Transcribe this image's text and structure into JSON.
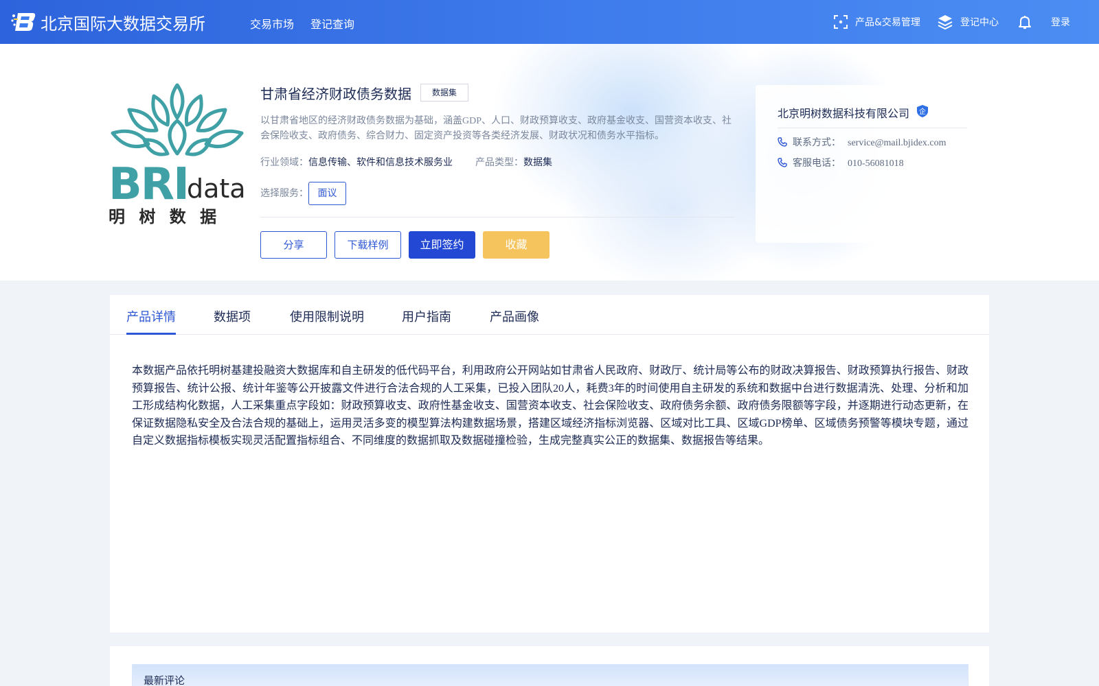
{
  "header": {
    "brand": "北京国际大数据交易所",
    "nav": [
      "交易市场",
      "登记查询"
    ],
    "product_manage": "产品&交易管理",
    "register_center": "登记中心",
    "login": "登录"
  },
  "product": {
    "title": "甘肃省经济财政债务数据",
    "type_badge": "数据集",
    "description": "以甘肃省地区的经济财政债务数据为基础，涵盖GDP、人口、财政预算收支、政府基金收支、国营资本收支、社会保险收支、政府债务、综合财力、固定资产投资等各类经济发展、财政状况和债务水平指标。",
    "industry_label": "行业领域：",
    "industry_value": "信息传输、软件和信息技术服务业",
    "product_type_label": "产品类型：",
    "product_type_value": "数据集",
    "service_label": "选择服务：",
    "service_option": "面议",
    "logo_brand_bri": "BRI",
    "logo_brand_data": "data",
    "logo_brand_cn": "明 树 数 据"
  },
  "actions": {
    "share": "分享",
    "download": "下载样例",
    "sign": "立即签约",
    "favorite": "收藏"
  },
  "company": {
    "name": "北京明树数据科技有限公司",
    "badge": "企",
    "contact_label": "联系方式：",
    "contact_value": "service@mail.bjidex.com",
    "phone_label": "客服电话：",
    "phone_value": "010-56081018"
  },
  "tabs": [
    "产品详情",
    "数据项",
    "使用限制说明",
    "用户指南",
    "产品画像"
  ],
  "detail": {
    "text": "本数据产品依托明树基建投融资大数据库和自主研发的低代码平台，利用政府公开网站如甘肃省人民政府、财政厅、统计局等公布的财政决算报告、财政预算执行报告、财政预算报告、统计公报、统计年鉴等公开披露文件进行合法合规的人工采集，已投入团队20人，耗费3年的时间使用自主研发的系统和数据中台进行数据清洗、处理、分析和加工形成结构化数据，人工采集重点字段如：财政预算收支、政府性基金收支、国营资本收支、社会保险收支、政府债务余额、政府债务限额等字段，并逐期进行动态更新，在保证数据隐私安全及合法合规的基础上，运用灵活多变的模型算法构建数据场景，搭建区域经济指标浏览器、区域对比工具、区域GDP榜单、区域债务预警等模块专题，通过自定义数据指标模板实现灵活配置指标组合、不同维度的数据抓取及数据碰撞检验，生成完整真实公正的数据集、数据报告等结果。"
  },
  "reviews": {
    "title": "最新评论"
  },
  "colors": {
    "primary": "#2248d4",
    "header_start": "#2d63dc",
    "header_end": "#4b8df3",
    "favorite": "#f6c45c",
    "logo_teal": "#3fa1a6",
    "logo_dark": "#2a2a2a"
  },
  "icons": {
    "scan": "scan-icon",
    "layers": "layers-icon",
    "bell": "bell-icon",
    "phone": "phone-icon",
    "enterprise": "enterprise-badge-icon"
  }
}
